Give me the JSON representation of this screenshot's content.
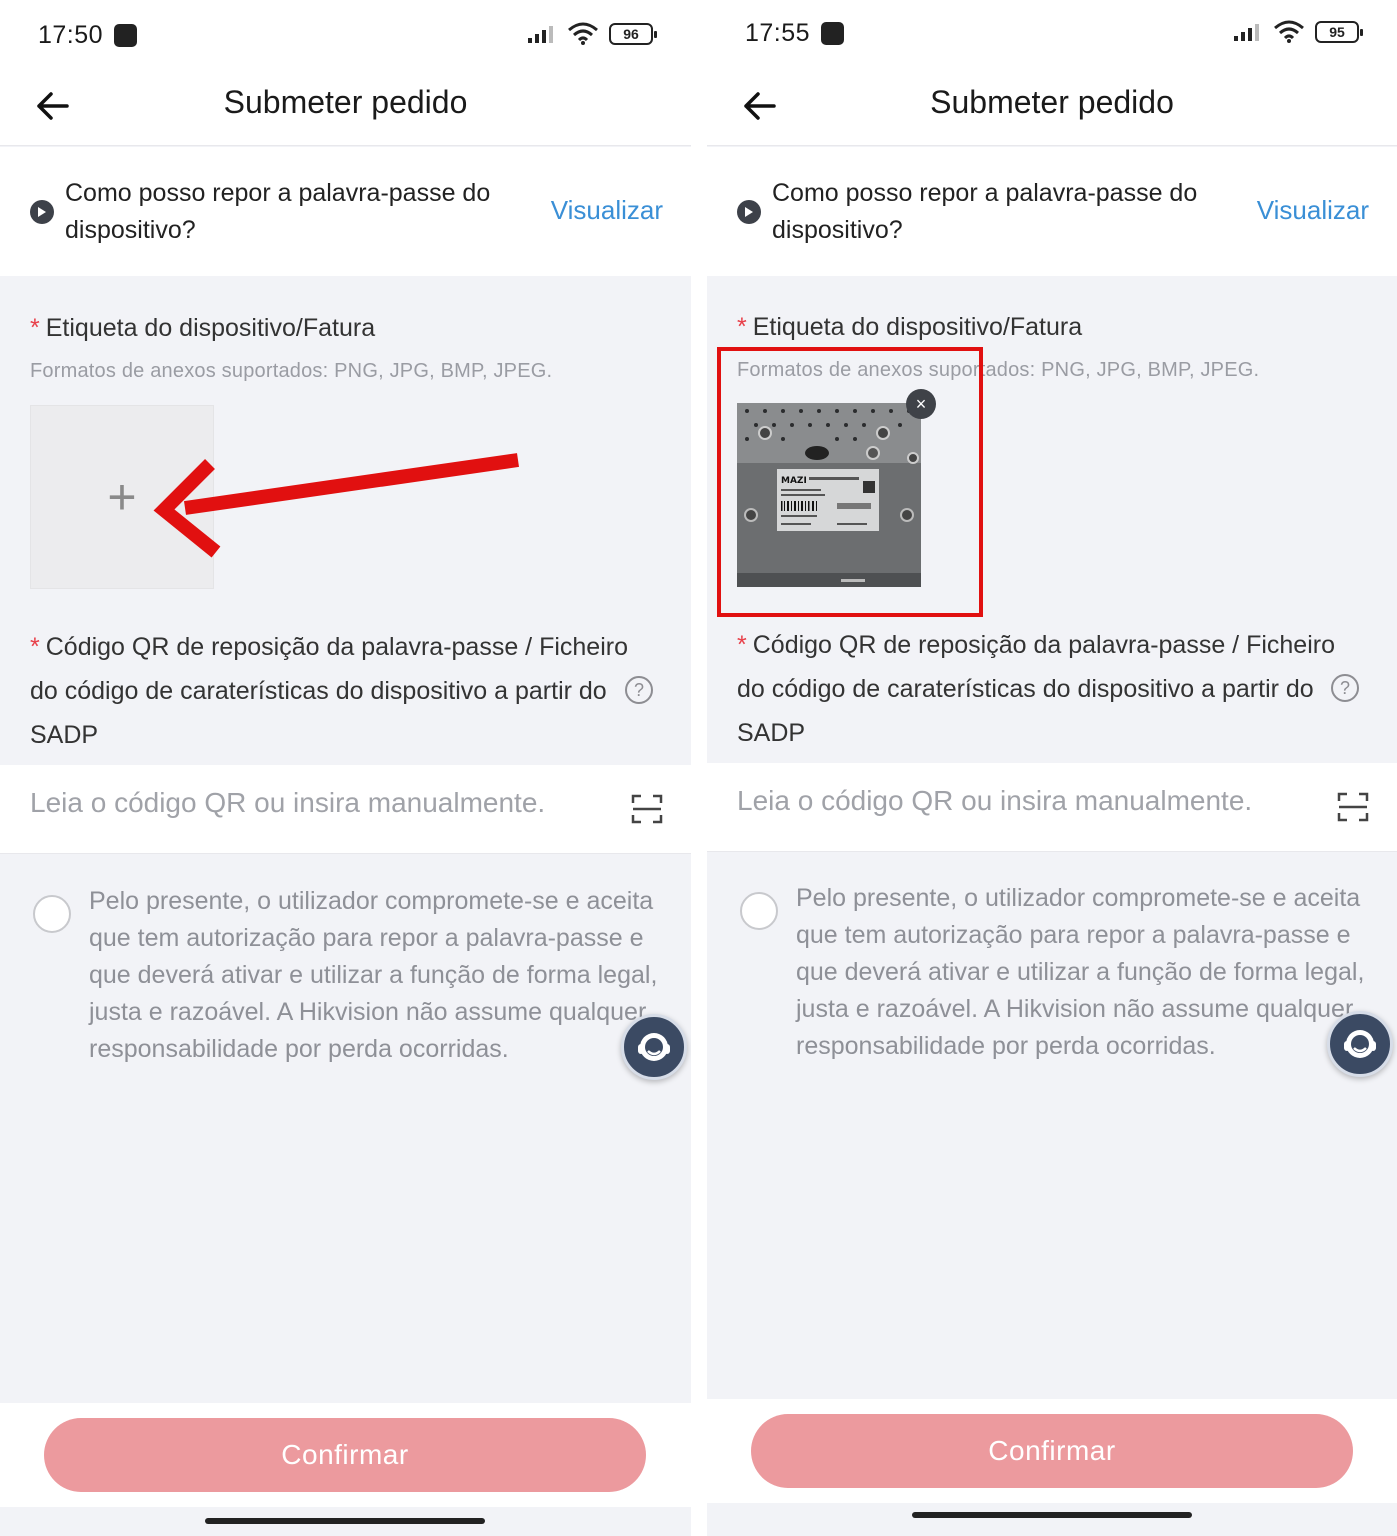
{
  "screens": [
    {
      "status": {
        "time": "17:50",
        "battery": "96"
      },
      "nav": {
        "title": "Submeter pedido"
      },
      "faq": {
        "question": "Como posso repor a palavra-passe do dispositivo?",
        "link": "Visualizar"
      },
      "device_label": {
        "required": "*",
        "label": "Etiqueta do dispositivo/Fatura",
        "hint": "Formatos de anexos suportados: PNG, JPG, BMP, JPEG."
      },
      "upload": {
        "plus": "+"
      },
      "qr": {
        "required": "*",
        "label": "Código QR de reposição da palavra-passe / Ficheiro do código de caraterísticas do dispositivo a partir do SADP",
        "placeholder": "Leia o código QR ou insira manualmente."
      },
      "agreement": {
        "text": "Pelo presente, o utilizador compromete-se e aceita que tem autorização para repor a palavra-passe e que deverá ativar e utilizar a função de forma legal, justa e razoável. A Hikvision não assume qualquer responsabilidade por perda ocorridas."
      },
      "confirm": "Confirmar"
    },
    {
      "status": {
        "time": "17:55",
        "battery": "95"
      },
      "nav": {
        "title": "Submeter pedido"
      },
      "faq": {
        "question": "Como posso repor a palavra-passe do dispositivo?",
        "link": "Visualizar"
      },
      "device_label": {
        "required": "*",
        "label": "Etiqueta do dispositivo/Fatura",
        "hint": "Formatos de anexos suportados: PNG, JPG, BMP, JPEG."
      },
      "thumbnail": {
        "close": "×",
        "brand": "MAZI"
      },
      "qr": {
        "required": "*",
        "label": "Código QR de reposição da palavra-passe / Ficheiro do código de caraterísticas do dispositivo a partir do SADP",
        "placeholder": "Leia o código QR ou insira manualmente."
      },
      "agreement": {
        "text": "Pelo presente, o utilizador compromete-se e aceita que tem autorização para repor a palavra-passe e que deverá ativar e utilizar a função de forma legal, justa e razoável. A Hikvision não assume qualquer responsabilidade por perda ocorridas."
      },
      "confirm": "Confirmar"
    }
  ],
  "colors": {
    "accent_link": "#3a8fd6",
    "required_star": "#e8404a",
    "confirm_button": "#ec9a9e",
    "annotation_red": "#e11010"
  },
  "icons": [
    "back-arrow-icon",
    "play-icon",
    "plus-icon",
    "help-icon",
    "scan-icon",
    "customer-support-icon",
    "close-icon",
    "signal-icon",
    "wifi-icon",
    "battery-icon"
  ]
}
